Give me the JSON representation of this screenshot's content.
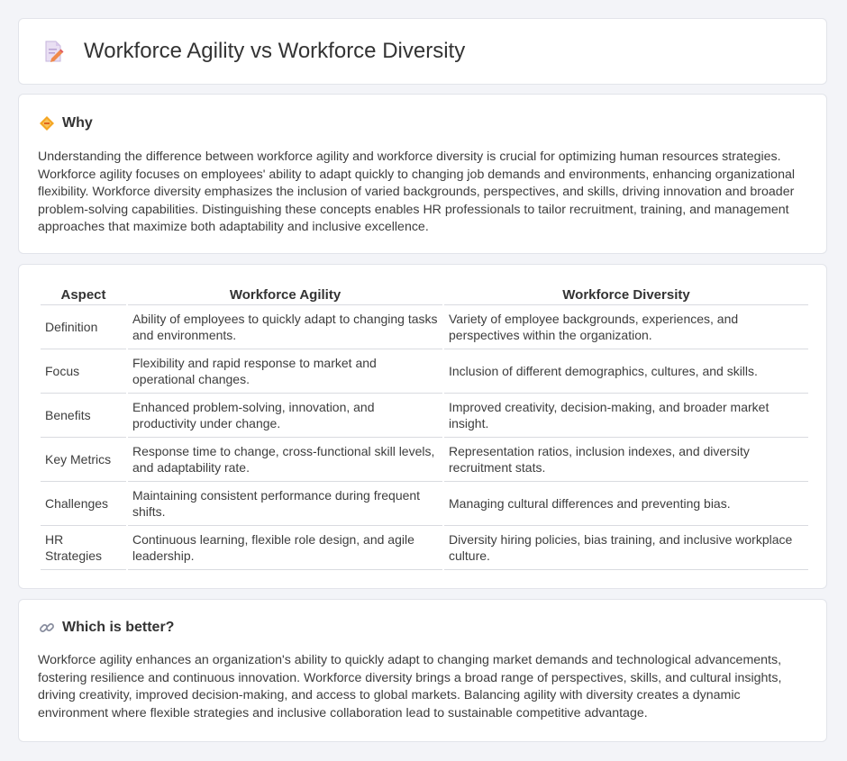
{
  "header": {
    "title": "Workforce Agility vs Workforce Diversity",
    "icon": "document-edit-icon"
  },
  "why": {
    "icon": "diamond-icon",
    "heading": "Why",
    "text": "Understanding the difference between workforce agility and workforce diversity is crucial for optimizing human resources strategies. Workforce agility focuses on employees' ability to adapt quickly to changing job demands and environments, enhancing organizational flexibility. Workforce diversity emphasizes the inclusion of varied backgrounds, perspectives, and skills, driving innovation and broader problem-solving capabilities. Distinguishing these concepts enables HR professionals to tailor recruitment, training, and management approaches that maximize both adaptability and inclusive excellence."
  },
  "table": {
    "headers": [
      "Aspect",
      "Workforce Agility",
      "Workforce Diversity"
    ],
    "rows": [
      {
        "aspect": "Definition",
        "agility": "Ability of employees to quickly adapt to changing tasks and environments.",
        "diversity": "Variety of employee backgrounds, experiences, and perspectives within the organization."
      },
      {
        "aspect": "Focus",
        "agility": "Flexibility and rapid response to market and operational changes.",
        "diversity": "Inclusion of different demographics, cultures, and skills."
      },
      {
        "aspect": "Benefits",
        "agility": "Enhanced problem-solving, innovation, and productivity under change.",
        "diversity": "Improved creativity, decision-making, and broader market insight."
      },
      {
        "aspect": "Key Metrics",
        "agility": "Response time to change, cross-functional skill levels, and adaptability rate.",
        "diversity": "Representation ratios, inclusion indexes, and diversity recruitment stats."
      },
      {
        "aspect": "Challenges",
        "agility": "Maintaining consistent performance during frequent shifts.",
        "diversity": "Managing cultural differences and preventing bias."
      },
      {
        "aspect": "HR Strategies",
        "agility": "Continuous learning, flexible role design, and agile leadership.",
        "diversity": "Diversity hiring policies, bias training, and inclusive workplace culture."
      }
    ]
  },
  "better": {
    "icon": "link-icon",
    "heading": "Which is better?",
    "text": "Workforce agility enhances an organization's ability to quickly adapt to changing market demands and technological advancements, fostering resilience and continuous innovation. Workforce diversity brings a broad range of perspectives, skills, and cultural insights, driving creativity, improved decision-making, and access to global markets. Balancing agility with diversity creates a dynamic environment where flexible strategies and inclusive collaboration lead to sustainable competitive advantage."
  },
  "colors": {
    "background": "#f3f4f8",
    "card": "#ffffff",
    "border": "#e2e4ea",
    "accent_orange": "#f5a623"
  }
}
